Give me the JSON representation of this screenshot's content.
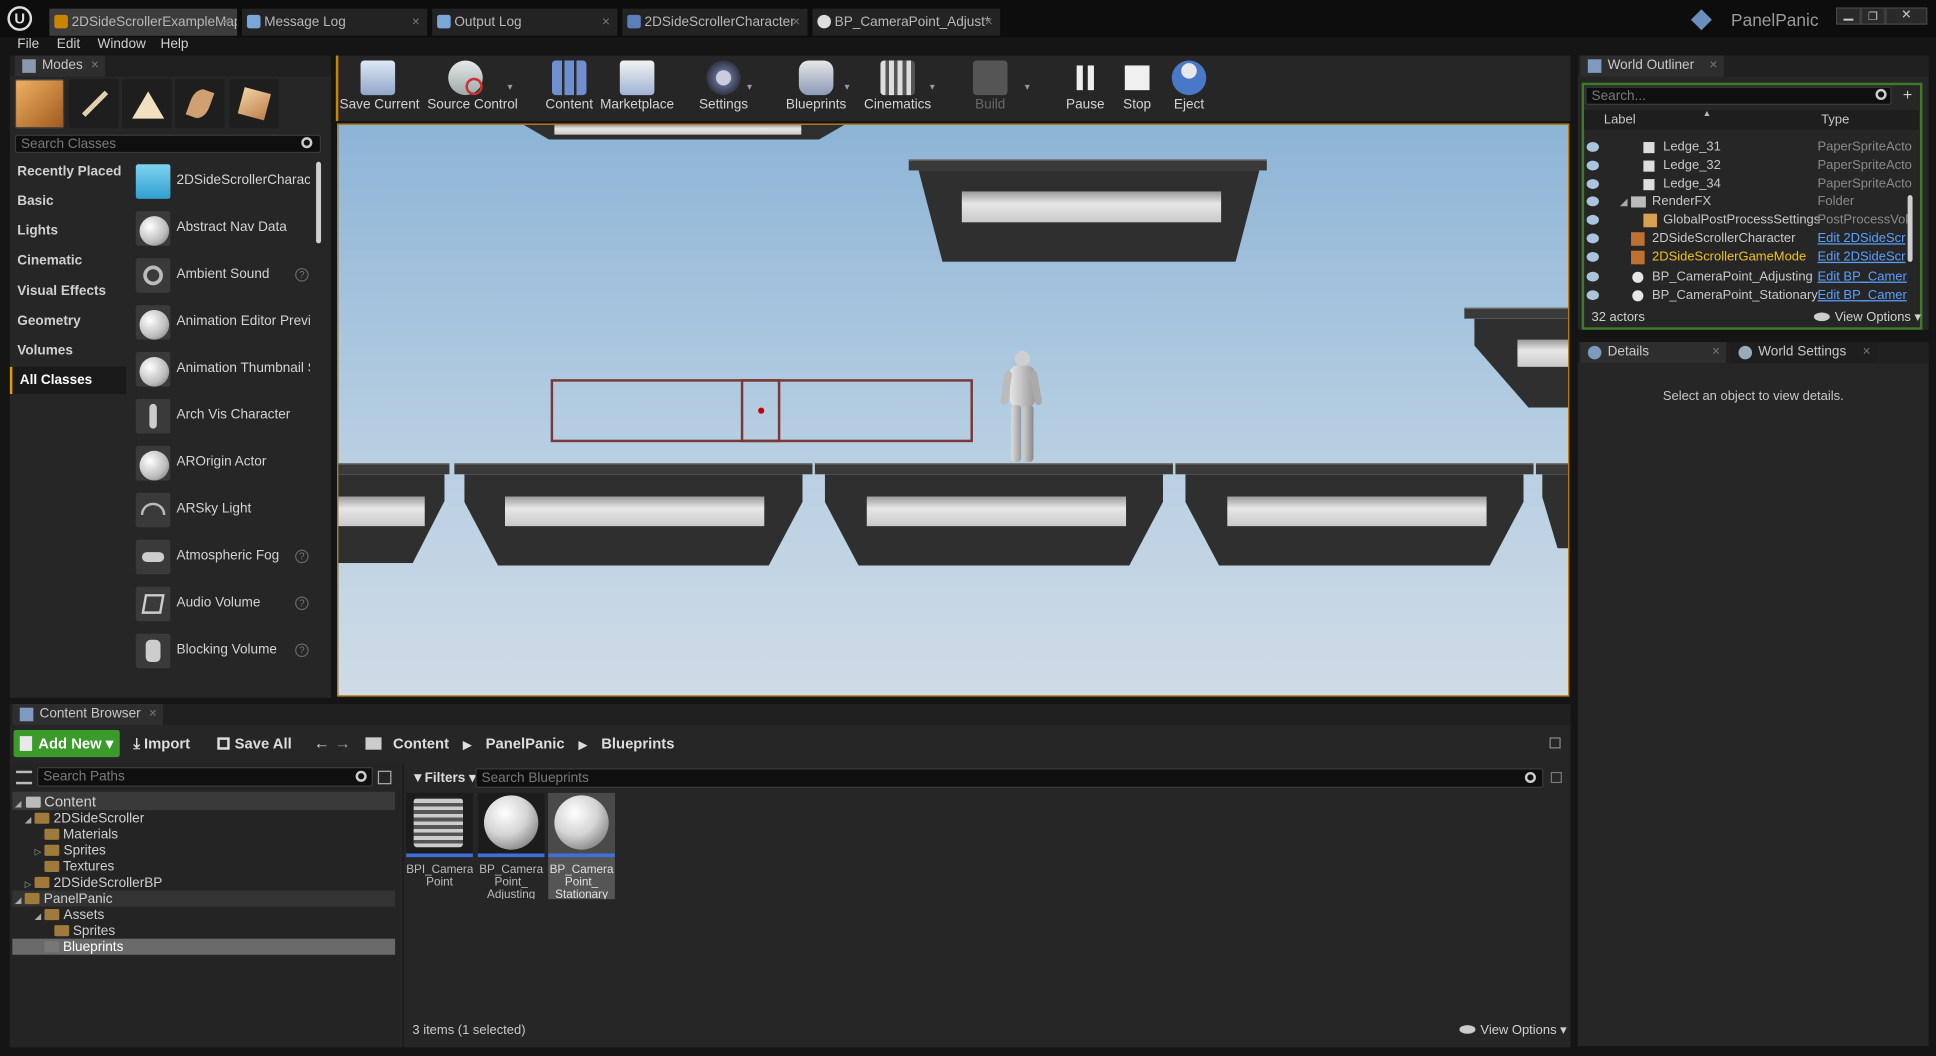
{
  "window": {
    "product_title": "PanelPanic",
    "tabs": [
      {
        "label": "2DSideScrollerExampleMap*",
        "active": true
      },
      {
        "label": "Message Log",
        "active": false
      },
      {
        "label": "Output Log",
        "active": false
      },
      {
        "label": "2DSideScrollerCharacter",
        "active": false
      },
      {
        "label": "BP_CameraPoint_Adjust*",
        "active": false
      }
    ],
    "close_glyph": "×"
  },
  "menu": {
    "items": [
      "File",
      "Edit",
      "Window",
      "Help"
    ]
  },
  "modes": {
    "tab_label": "Modes",
    "search_placeholder": "Search Classes",
    "mode_icons": [
      "place-mode-icon",
      "paint-mode-icon",
      "landscape-mode-icon",
      "foliage-mode-icon",
      "geometry-mode-icon"
    ],
    "categories": [
      "Recently Placed",
      "Basic",
      "Lights",
      "Cinematic",
      "Visual Effects",
      "Geometry",
      "Volumes",
      "All Classes"
    ],
    "selected_category": "All Classes",
    "items": [
      {
        "label": "2DSideScrollerCharact",
        "help": false
      },
      {
        "label": "Abstract Nav Data",
        "help": false
      },
      {
        "label": "Ambient Sound",
        "help": true
      },
      {
        "label": "Animation Editor Previe",
        "help": false
      },
      {
        "label": "Animation Thumbnail S",
        "help": false
      },
      {
        "label": "Arch Vis Character",
        "help": false
      },
      {
        "label": "AROrigin Actor",
        "help": false
      },
      {
        "label": "ARSky Light",
        "help": false
      },
      {
        "label": "Atmospheric Fog",
        "help": true
      },
      {
        "label": "Audio Volume",
        "help": true
      },
      {
        "label": "Blocking Volume",
        "help": true
      }
    ],
    "help_glyph": "?"
  },
  "toolbar": {
    "buttons": [
      {
        "label": "Save Current",
        "icon": "save-icon",
        "enabled": true,
        "dropdown": false
      },
      {
        "label": "Source Control",
        "icon": "source-control-icon",
        "enabled": true,
        "dropdown": true
      },
      {
        "label": "Content",
        "icon": "content-icon",
        "enabled": true,
        "dropdown": false
      },
      {
        "label": "Marketplace",
        "icon": "marketplace-icon",
        "enabled": true,
        "dropdown": false
      },
      {
        "label": "Settings",
        "icon": "settings-icon",
        "enabled": true,
        "dropdown": true
      },
      {
        "label": "Blueprints",
        "icon": "blueprints-icon",
        "enabled": true,
        "dropdown": true
      },
      {
        "label": "Cinematics",
        "icon": "cinematics-icon",
        "enabled": true,
        "dropdown": true
      },
      {
        "label": "Build",
        "icon": "build-icon",
        "enabled": false,
        "dropdown": true
      },
      {
        "label": "Pause",
        "icon": "pause-icon",
        "enabled": true,
        "dropdown": false
      },
      {
        "label": "Stop",
        "icon": "stop-icon",
        "enabled": true,
        "dropdown": false
      },
      {
        "label": "Eject",
        "icon": "eject-icon",
        "enabled": true,
        "dropdown": false
      }
    ],
    "dropdown_glyph": "▾"
  },
  "world_outliner": {
    "tab_label": "World Outliner",
    "search_placeholder": "Search...",
    "columns": {
      "label": "Label",
      "type": "Type"
    },
    "rows": [
      {
        "label": "Ledge_31",
        "type": "PaperSpriteActo",
        "link": false,
        "highlight": false
      },
      {
        "label": "Ledge_32",
        "type": "PaperSpriteActo",
        "link": false,
        "highlight": false
      },
      {
        "label": "Ledge_34",
        "type": "PaperSpriteActo",
        "link": false,
        "highlight": false
      },
      {
        "label": "RenderFX",
        "type": "Folder",
        "link": false,
        "highlight": false
      },
      {
        "label": "GlobalPostProcessSettings",
        "type": "PostProcessVol",
        "link": false,
        "highlight": false
      },
      {
        "label": "2DSideScrollerCharacter",
        "type": "Edit 2DSideScr",
        "link": true,
        "highlight": false
      },
      {
        "label": "2DSideScrollerGameMode",
        "type": "Edit 2DSideScr",
        "link": true,
        "highlight": true
      },
      {
        "label": "BP_CameraPoint_Adjusting",
        "type": "Edit BP_Camer",
        "link": true,
        "highlight": false
      },
      {
        "label": "BP_CameraPoint_Stationary",
        "type": "Edit BP_Camer",
        "link": true,
        "highlight": false
      }
    ],
    "actor_count": "32 actors",
    "view_options": "View Options"
  },
  "details": {
    "tab_label": "Details",
    "world_settings_tab": "World Settings",
    "empty_message": "Select an object to view details."
  },
  "content_browser": {
    "tab_label": "Content Browser",
    "add_new": "Add New",
    "import": "Import",
    "save_all": "Save All",
    "breadcrumb": [
      "Content",
      "PanelPanic",
      "Blueprints"
    ],
    "search_paths_placeholder": "Search Paths",
    "filters_label": "Filters",
    "search_assets_placeholder": "Search Blueprints",
    "tree": [
      {
        "label": "Content",
        "level": 0,
        "root": true
      },
      {
        "label": "2DSideScroller",
        "level": 1
      },
      {
        "label": "Materials",
        "level": 2
      },
      {
        "label": "Sprites",
        "level": 2
      },
      {
        "label": "Textures",
        "level": 2
      },
      {
        "label": "2DSideScrollerBP",
        "level": 1
      },
      {
        "label": "PanelPanic",
        "level": 1
      },
      {
        "label": "Assets",
        "level": 2
      },
      {
        "label": "Sprites",
        "level": 3
      },
      {
        "label": "Blueprints",
        "level": 2,
        "selected": true
      }
    ],
    "assets": [
      {
        "name": "BPI_Camera Point",
        "type": "interface",
        "selected": false
      },
      {
        "name": "BP_Camera Point_ Adjusting",
        "type": "blueprint",
        "selected": false
      },
      {
        "name": "BP_Camera Point_ Stationary",
        "type": "blueprint",
        "selected": true
      }
    ],
    "status": "3 items (1 selected)",
    "view_options": "View Options"
  },
  "colors": {
    "accent_orange": "#e0a000",
    "link_blue": "#5aa0ff",
    "add_new_green": "#3a9a2a",
    "sky_top": "#8db4d6",
    "highlight_yellow": "#f0c020"
  }
}
